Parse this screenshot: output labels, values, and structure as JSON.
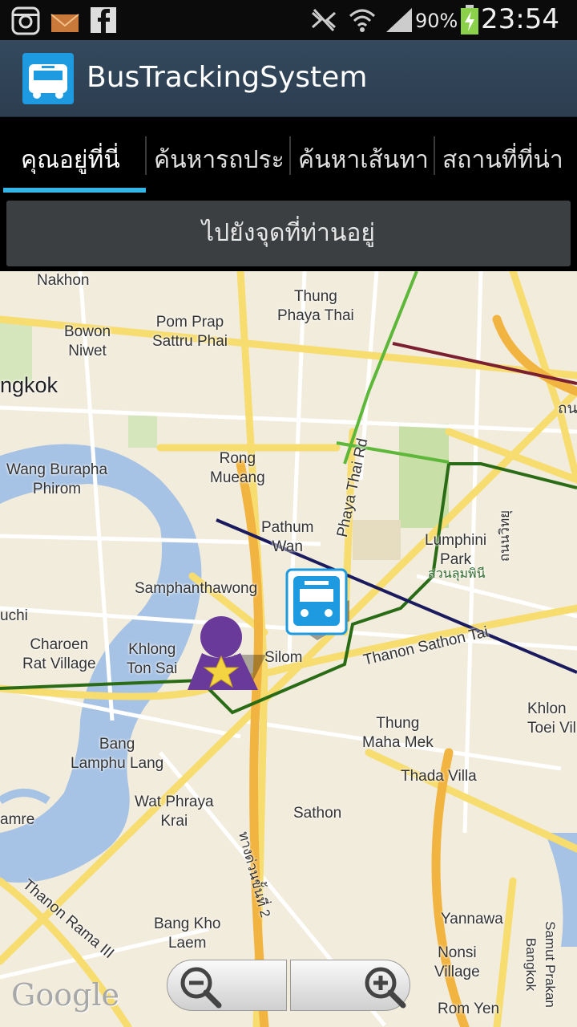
{
  "status_bar": {
    "battery_percent": "90%",
    "time": "23:54",
    "icons": [
      "instagram-icon",
      "mail-icon",
      "facebook-icon",
      "mute-icon",
      "wifi-icon",
      "signal-icon",
      "battery-charging-icon"
    ]
  },
  "app": {
    "title": "BusTrackingSystem",
    "icon": "bus-icon",
    "accent_color": "#1e9be0"
  },
  "tabs": [
    {
      "label": "คุณอยู่ที่นี่",
      "active": true
    },
    {
      "label": "ค้นหารถประ",
      "active": false
    },
    {
      "label": "ค้นหาเส้นทา",
      "active": false
    },
    {
      "label": "สถานที่ที่น่า",
      "active": false
    }
  ],
  "goto_button": {
    "label": "ไปยังจุดที่ท่านอยู่"
  },
  "map": {
    "labels": {
      "nakhon": "Nakhon",
      "thung_phaya_thai": "Thung\nPhaya Thai",
      "bowon_niwet": "Bowon\nNiwet",
      "pom_prap": "Pom Prap\nSattru Phai",
      "bangkok": "ngkok",
      "wang_burapha": "Wang Burapha\nPhirom",
      "rong_mueang": "Rong\nMueang",
      "phaya_thai_rd": "Phaya Thai Rd",
      "pathum_wan": "Pathum\nWan",
      "lumphini_park": "Lumphini\nPark",
      "lumphini_th": "สวนลุมพินี",
      "thanon_witthayu": "ถนนวิทยุ",
      "samphanthawong": "Samphanthawong",
      "uchi": "uchi",
      "charoen": "Charoen\nRat Village",
      "khlong_ton_sai": "Khlong\nTon Sai",
      "silom": "Silom",
      "sathon_tai": "Thanon Sathon Tai",
      "khlong_toei": "Khlon\nToei Vil",
      "thung_maha_mek": "Thung\nMaha Mek",
      "bang_lamphu_lang": "Bang\nLamphu Lang",
      "thada_villa": "Thada Villa",
      "wat_phraya_krai": "Wat Phraya\nKrai",
      "sathon": "Sathon",
      "amre": "amre",
      "thang_duan": "ทางด่วนขั้นที่ 2",
      "thanon_rama_iii": "Thanon Rama III",
      "bang_kho_laem": "Bang Kho\nLaem",
      "yannawa": "Yannawa",
      "nonsi_village": "Nonsi\nVillage",
      "rom_yen": "Rom Yen",
      "samut_prakan": "Samut Prakan\nBangkok",
      "thanon_top": "ถน"
    },
    "markers": [
      "bus-marker-icon",
      "user-location-icon"
    ],
    "attribution": "Google"
  },
  "zoom": {
    "out_icon": "zoom-out-icon",
    "in_icon": "zoom-in-icon"
  }
}
